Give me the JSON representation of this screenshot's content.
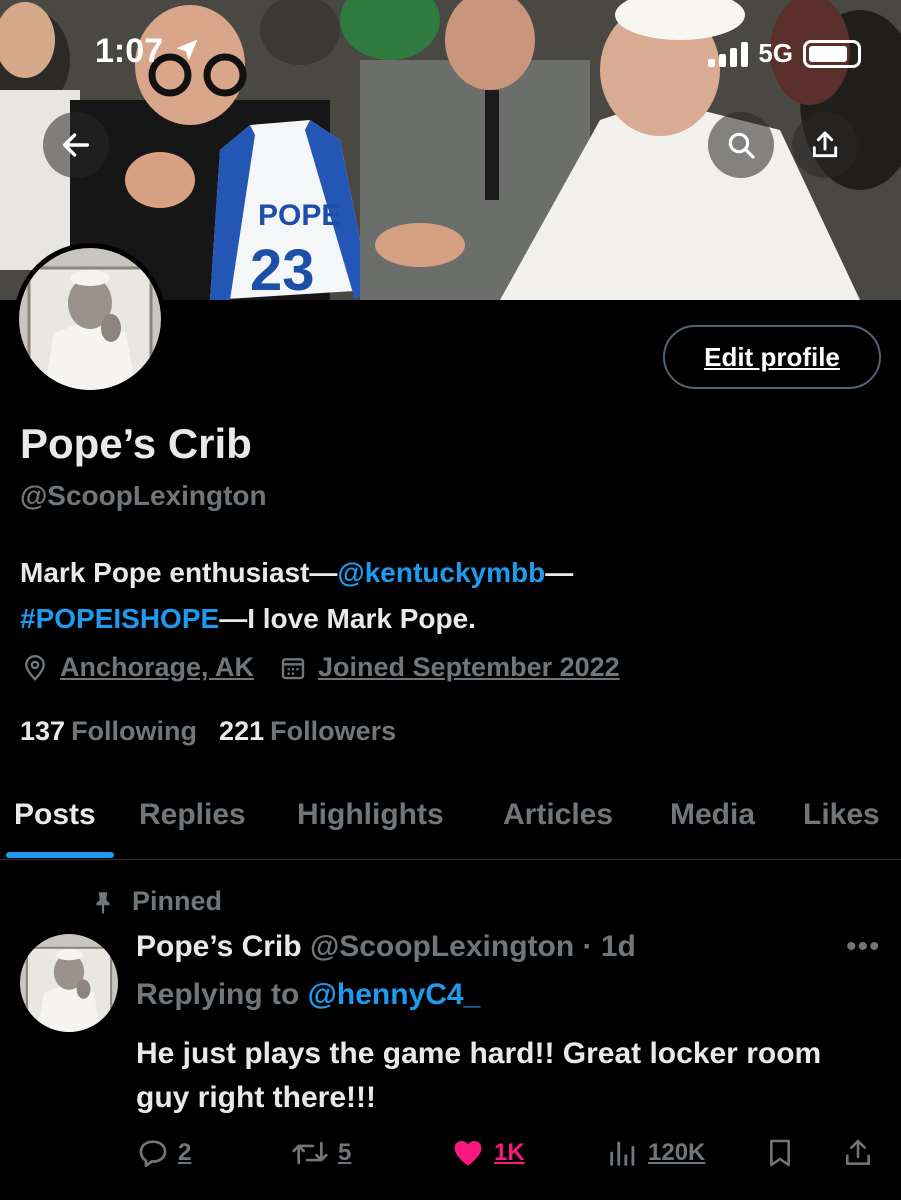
{
  "status_bar": {
    "time": "1:07",
    "network": "5G"
  },
  "profile": {
    "display_name": "Pope’s Crib",
    "handle": "@ScoopLexington",
    "edit_button": "Edit profile",
    "bio": {
      "part1": "Mark Pope enthusiast—",
      "mention": "@kentuckymbb",
      "part2": "—",
      "hashtag": "#POPEISHOPE",
      "part3": "—I love Mark Pope."
    },
    "location": "Anchorage, AK",
    "joined": "Joined September 2022",
    "following_count": "137",
    "following_label": "Following",
    "followers_count": "221",
    "followers_label": "Followers"
  },
  "tabs": [
    "Posts",
    "Replies",
    "Highlights",
    "Articles",
    "Media",
    "Likes"
  ],
  "pinned_label": "Pinned",
  "tweet": {
    "name": "Pope’s Crib",
    "handle": "@ScoopLexington",
    "time": "· 1d",
    "replying_prefix": "Replying to ",
    "replying_to": "@hennyC4_",
    "text": "He just plays the game hard!! Great locker room guy right there!!!",
    "replies": "2",
    "retweets": "5",
    "likes": "1K",
    "views": "120K"
  },
  "banner": {
    "jersey_name": "POPE",
    "jersey_number": "23"
  },
  "colors": {
    "accent": "#1d9bf0",
    "like": "#f91880",
    "muted": "#71767b",
    "text": "#e7e9ea"
  },
  "icons": [
    "back-arrow-icon",
    "search-icon",
    "share-icon",
    "location-pin-icon",
    "calendar-icon",
    "pin-icon",
    "more-icon",
    "reply-icon",
    "retweet-icon",
    "heart-icon",
    "views-icon",
    "bookmark-icon",
    "upload-icon"
  ]
}
